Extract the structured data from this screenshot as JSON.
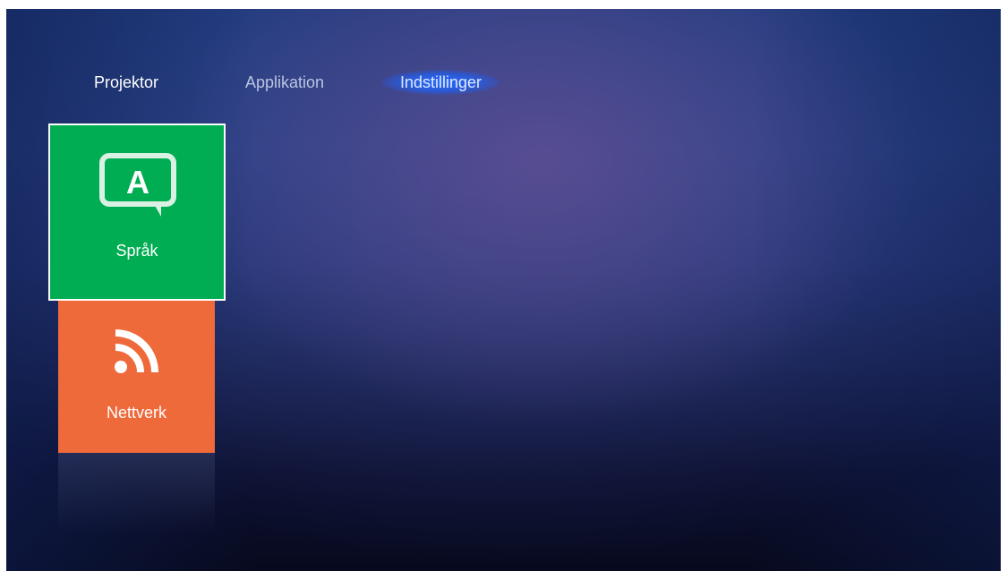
{
  "tabs": {
    "projektor": "Projektor",
    "applikation": "Applikation",
    "indstillinger": "Indstillinger",
    "active": "Indstillinger"
  },
  "tiles": {
    "sprak": {
      "label": "Språk",
      "icon": "language-bubble-icon",
      "color": "#00ad52"
    },
    "nettverk": {
      "label": "Nettverk",
      "icon": "network-rss-icon",
      "color": "#ee6a3b"
    }
  },
  "colors": {
    "focus_border": "#ffffff",
    "active_tab_glow": "#2b6bff"
  }
}
